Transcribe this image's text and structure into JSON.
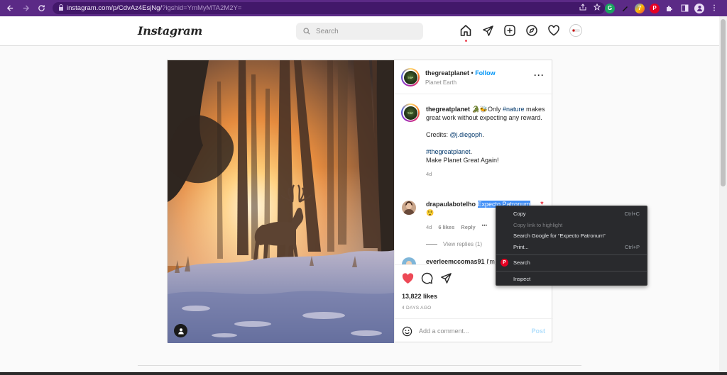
{
  "browser": {
    "url_main": "instagram.com/p/CdvAz4EsjNg/",
    "url_query": "?igshid=YmMyMTA2M2Y="
  },
  "header": {
    "logo": "Instagram",
    "search_placeholder": "Search"
  },
  "post": {
    "author": "thegreatplanet",
    "follow_label": "Follow",
    "location": "Planet Earth",
    "caption": {
      "author": "thegreatplanet",
      "line1_emoji": "🐊🐝",
      "line1_text": "Only ",
      "hashtag1": "#nature",
      "line2": "makes great work without expecting any reward.",
      "credits_label": "Credits: ",
      "credits_handle": "@j.diegoph",
      "credits_end": ".",
      "hashtag2": "#thegreatplanet",
      "hashtag2_end": ".",
      "line_last": "Make Planet Great Again!",
      "time": "4d"
    },
    "comments": [
      {
        "author": "drapaulabotelho",
        "text_selected": "Expecto Patronum",
        "emoji": "😲",
        "time": "4d",
        "likes": "6 likes",
        "reply": "Reply",
        "more": "•••",
        "view_replies": "View replies (1)"
      },
      {
        "author": "everleemccomas91",
        "text": "I'm a"
      }
    ],
    "likes": "13,822 likes",
    "time_ago": "4 DAYS AGO",
    "add_comment_placeholder": "Add a comment...",
    "post_button": "Post"
  },
  "context_menu": {
    "items": [
      {
        "label": "Copy",
        "shortcut": "Ctrl+C"
      },
      {
        "label": "Copy link to highlight",
        "shortcut": ""
      },
      {
        "label": "Search Google for “Expecto Patronum”",
        "shortcut": ""
      },
      {
        "label": "Print...",
        "shortcut": "Ctrl+P"
      },
      {
        "label": "Search",
        "shortcut": ""
      },
      {
        "label": "Inspect",
        "shortcut": ""
      }
    ]
  },
  "colors": {
    "chrome": "#5b2a86",
    "link": "#0095f6",
    "heart": "#ed4956",
    "selection": "#3f8ef7"
  }
}
